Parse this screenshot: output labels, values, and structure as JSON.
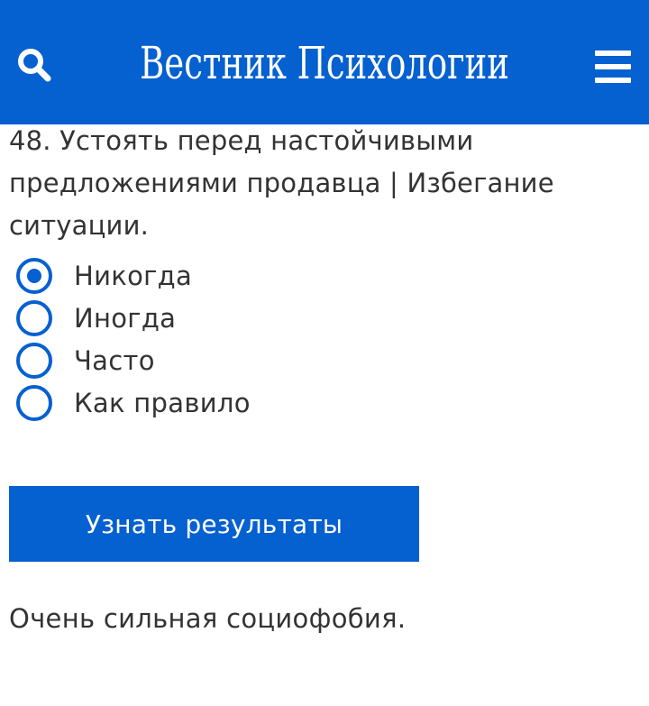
{
  "header": {
    "logo_text": "Вестник Психологии",
    "search_icon": "search-icon",
    "menu_icon": "hamburger-menu-icon",
    "background_color": "#0560d0"
  },
  "question": {
    "text": "48. Устоять перед настойчивыми предложениями продавца | Избегание ситуации."
  },
  "options": [
    {
      "label": "Никогда",
      "checked": true
    },
    {
      "label": "Иногда",
      "checked": false
    },
    {
      "label": "Часто",
      "checked": false
    },
    {
      "label": "Как правило",
      "checked": false
    }
  ],
  "result_button": {
    "label": "Узнать результаты"
  },
  "result": {
    "text": "Очень сильная социофобия."
  },
  "colors": {
    "accent": "#0560d0",
    "text": "#333333",
    "background": "#ffffff"
  }
}
